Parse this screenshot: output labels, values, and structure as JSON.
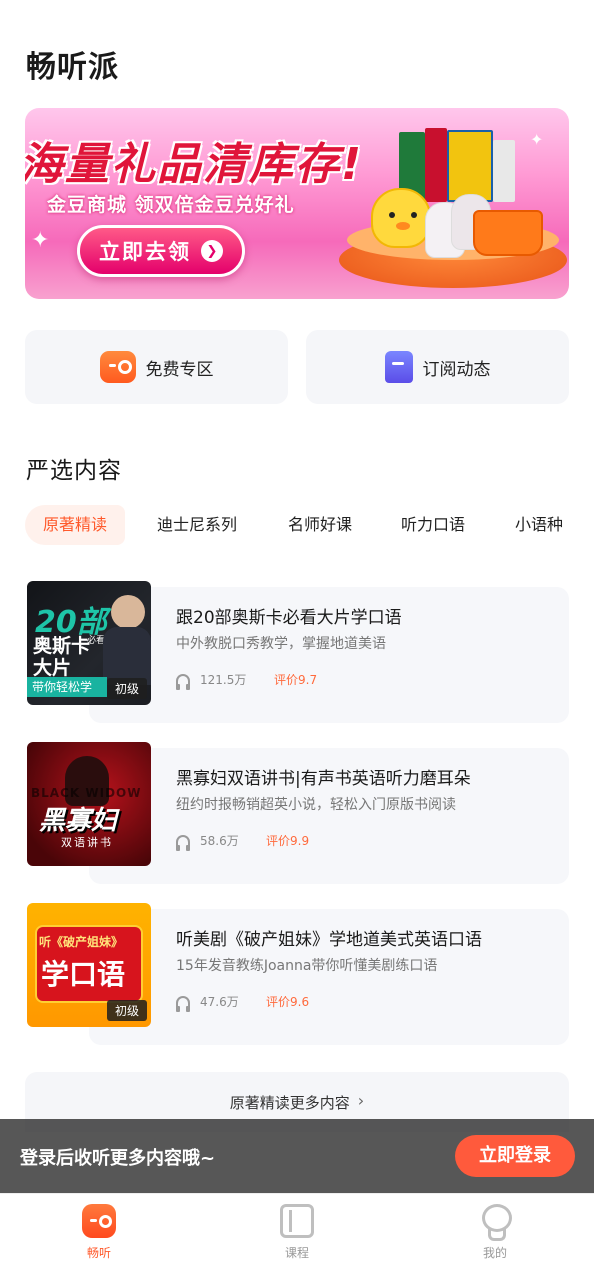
{
  "app": {
    "title": "畅听派"
  },
  "banner": {
    "headline": "海量礼品清库存!",
    "subtitle": "金豆商城  领双倍金豆兑好礼",
    "cta": "立即去领"
  },
  "quick_entries": [
    {
      "label": "免费专区",
      "icon": "radio-icon"
    },
    {
      "label": "订阅动态",
      "icon": "bookmark-icon"
    }
  ],
  "section": {
    "title": "严选内容"
  },
  "tabs": [
    "原著精读",
    "迪士尼系列",
    "名师好课",
    "听力口语",
    "小语种"
  ],
  "courses": [
    {
      "title": "跟20部奥斯卡必看大片学口语",
      "desc": "中外教脱口秀教学，掌握地道美语",
      "plays": "121.5万",
      "rating": "评价9.7",
      "level": "初级",
      "cover_text": [
        "20部",
        "奥斯卡",
        "必看",
        "大片",
        "带你轻松学"
      ]
    },
    {
      "title": "黑寡妇双语讲书|有声书英语听力磨耳朵",
      "desc": "纽约时报畅销超英小说，轻松入门原版书阅读",
      "plays": "58.6万",
      "rating": "评价9.9",
      "cover_text": [
        "BLACK WIDOW",
        "黑寡妇",
        "双语讲书"
      ]
    },
    {
      "title": "听美剧《破产姐妹》学地道美式英语口语",
      "desc": "15年发音教练Joanna带你听懂美剧练口语",
      "plays": "47.6万",
      "rating": "评价9.6",
      "level": "初级",
      "cover_text": [
        "听《破产姐妹》",
        "学口语"
      ]
    }
  ],
  "more": {
    "label": "原著精读更多内容"
  },
  "login_bar": {
    "text": "登录后收听更多内容哦~",
    "button": "立即登录"
  },
  "tabbar": [
    {
      "label": "畅听",
      "active": true
    },
    {
      "label": "课程",
      "active": false
    },
    {
      "label": "我的",
      "active": false
    }
  ],
  "colors": {
    "accent": "#ff5a2c",
    "rating": "#ff6a3c",
    "login_button": "#ff5a3c"
  }
}
